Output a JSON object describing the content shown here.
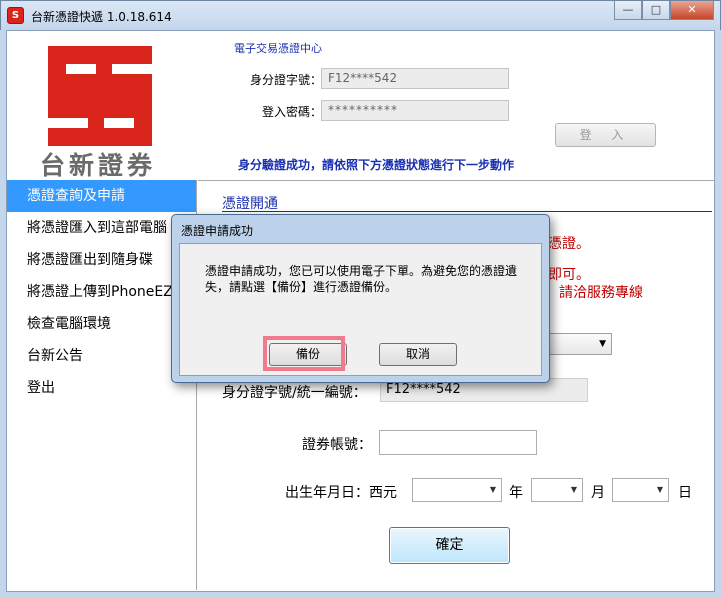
{
  "window": {
    "title": "台新憑證快遞 1.0.18.614",
    "icon_letter": "S",
    "minimize": "—",
    "maximize": "□",
    "close": "✕"
  },
  "header": {
    "brand": "台新證券",
    "center_title": "電子交易憑證中心",
    "id_label": "身分證字號：",
    "id_value": "F12****542",
    "pw_label": "登入密碼：",
    "pw_value": "**********",
    "login_button": "登 入",
    "status": "身分驗證成功，請依照下方憑證狀態進行下一步動作"
  },
  "sidebar": {
    "items": [
      {
        "label": "憑證查詢及申請"
      },
      {
        "label": "將憑證匯入到這部電腦"
      },
      {
        "label": "將憑證匯出到隨身碟"
      },
      {
        "label": "將憑證上傳到PhoneEZ"
      },
      {
        "label": "檢查電腦環境"
      },
      {
        "label": "台新公告"
      },
      {
        "label": "登出"
      }
    ]
  },
  "main": {
    "section_title": "憑證開通",
    "red_line_1": "憑證。",
    "red_line_2": "即可。",
    "red_line_3": "，請洽服務專線",
    "id_label": "身分證字號/統一編號：",
    "id_value": "F12****542",
    "account_label": "證券帳號：",
    "account_value": "",
    "birthday_label": "出生年月日：西元",
    "year_unit": "年",
    "month_unit": "月",
    "day_unit": "日",
    "confirm_button": "確定"
  },
  "dialog": {
    "title": "憑證申請成功",
    "message": "憑證申請成功，您已可以使用電子下單。為避免您的憑證遺失，請點選【備份】進行憑證備份。",
    "backup_button": "備份",
    "cancel_button": "取消"
  },
  "colors": {
    "accent_blue": "#3399ff",
    "link_blue": "#1a2fb0",
    "brand_red": "#d9251c",
    "warning_red": "#c00000",
    "highlight_pink": "#f07b8f"
  }
}
